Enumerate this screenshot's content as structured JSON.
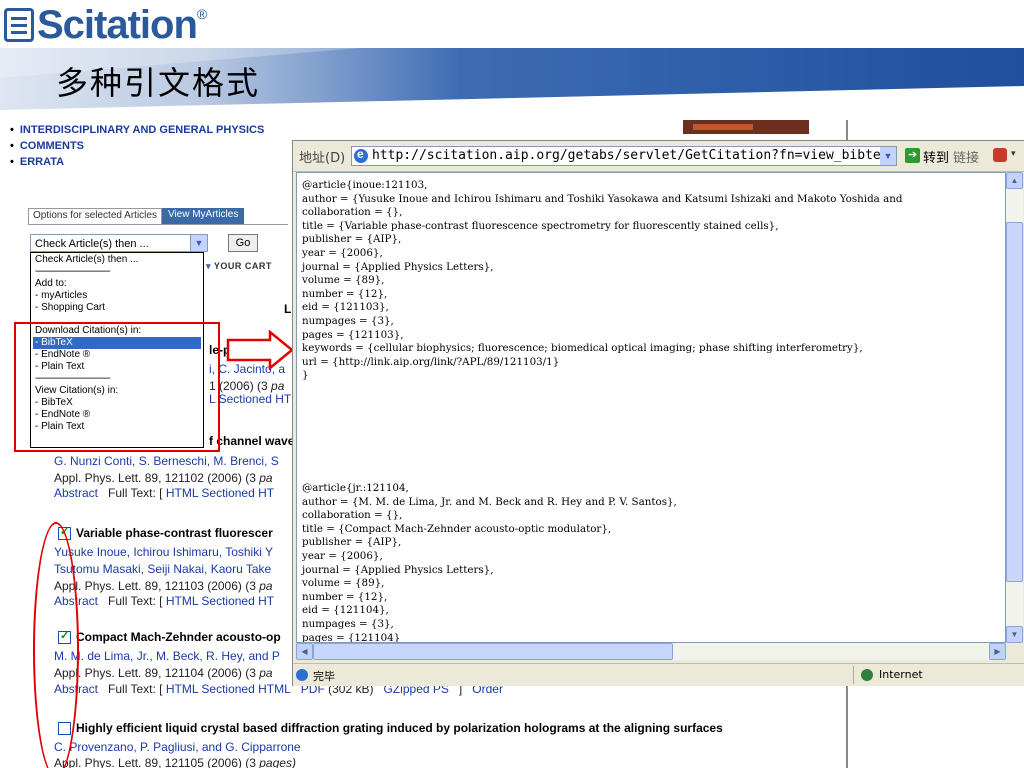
{
  "header": {
    "logo_text": "Scitation",
    "logo_mark": "®",
    "slide_title": "多种引文格式"
  },
  "colors": {
    "brand_blue": "#2a5a9c",
    "highlight_red": "#e00000",
    "link_blue": "#1a3aa8",
    "selection_blue": "#316ac5"
  },
  "page": {
    "top_links": [
      "INTERDISCIPLINARY AND GENERAL PHYSICS",
      "COMMENTS",
      "ERRATA"
    ],
    "options_tab": "Options for selected Articles",
    "myarticles_tab": "View MyArticles",
    "select_value": "Check Article(s) then ...",
    "go_label": "Go",
    "cart_label": "YOUR CART",
    "dropdown_items": [
      "Check Article(s) then ...",
      "--------------------------------",
      "Add to:",
      "- myArticles",
      "- Shopping Cart",
      "",
      "Download Citation(s) in:",
      "- BibTeX",
      "- EndNote ®",
      "- Plain Text",
      "--------------------------------",
      "View Citation(s) in:",
      "- BibTeX",
      "- EndNote ®",
      "- Plain Text"
    ],
    "stray_letter": "L",
    "articles": [
      {
        "title": "le-pumped Yb",
        "authors": "i, C. Jacinto, a",
        "ref": "1 (2006) (3 pa",
        "links": "L Sectioned HT"
      },
      {
        "title": "f channel wave",
        "authors": "G. Nunzi Conti, S. Berneschi, M. Brenci, S",
        "ref": "Appl. Phys. Lett. 89, 121102 (2006) (3 pa",
        "links_a": "Abstract",
        "links_b": "Full Text: [",
        "links_c": "HTML Sectioned HT"
      },
      {
        "title": "Variable phase-contrast fluorescer",
        "authors1": "Yusuke Inoue, Ichirou Ishimaru, Toshiki Y",
        "authors2": "Tsutomu Masaki, Seiji Nakai, Kaoru Take",
        "ref": "Appl. Phys. Lett. 89, 121103 (2006) (3 pa",
        "links_a": "Abstract",
        "links_b": "Full Text: [",
        "links_c": "HTML Sectioned HT"
      },
      {
        "title": "Compact Mach-Zehnder acousto-op",
        "authors": "M. M. de Lima, Jr., M. Beck, R. Hey, and P",
        "ref": "Appl. Phys. Lett. 89, 121104 (2006) (3 pa",
        "links_a": "Abstract",
        "links_b": "Full Text: [",
        "links_c": "HTML Sectioned HTML",
        "links_d": "PDF",
        "links_e": "(302 kB)",
        "links_f": "GZipped PS",
        "links_g": "]",
        "links_h": "Order"
      },
      {
        "title": "Highly efficient liquid crystal based diffraction grating induced by polarization holograms at the aligning surfaces",
        "authors": "C. Provenzano, P. Pagliusi, and G. Cipparrone",
        "ref": "Appl. Phys. Lett. 89, 121105 (2006) (3 pages)"
      }
    ]
  },
  "browser": {
    "address_label": "地址(D)",
    "url": "http://scitation.aip.org/getabs/servlet/GetCitation?fn=view_bibtex",
    "go_label": "转到",
    "links_label": "链接",
    "status_text": "完毕",
    "zone_text": "Internet",
    "bibtex_1": [
      "@article{inoue:121103,",
      "author = {Yusuke Inoue and Ichirou Ishimaru and Toshiki Yasokawa and Katsumi Ishizaki and Makoto Yoshida and",
      "collaboration = {},",
      "title = {Variable phase-contrast fluorescence spectrometry for fluorescently stained cells},",
      "publisher = {AIP},",
      "year = {2006},",
      "journal = {Applied Physics Letters},",
      "volume = {89},",
      "number = {12},",
      "eid = {121103},",
      "numpages = {3},",
      "pages = {121103},",
      "keywords = {cellular biophysics; fluorescence; biomedical optical imaging; phase shifting interferometry},",
      "url = {http://link.aip.org/link/?APL/89/121103/1}",
      "}"
    ],
    "bibtex_2": [
      "@article{jr.:121104,",
      "author = {M. M. de Lima, Jr. and M. Beck and R. Hey and P. V. Santos},",
      "collaboration = {},",
      "title = {Compact Mach-Zehnder acousto-optic modulator},",
      "publisher = {AIP},",
      "year = {2006},",
      "journal = {Applied Physics Letters},",
      "volume = {89},",
      "number = {12},",
      "eid = {121104},",
      "numpages = {3},",
      "pages = {121104}"
    ]
  }
}
